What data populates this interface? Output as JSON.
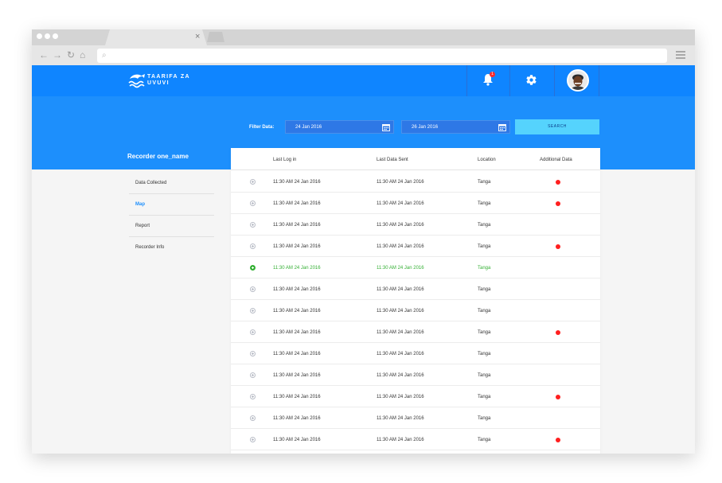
{
  "browser": {
    "tab_close": "×",
    "nav_back": "←",
    "nav_forward": "→",
    "nav_reload": "↻",
    "nav_home": "⌂",
    "url_search_icon": "⌕"
  },
  "app": {
    "logo_line1": "TAARIFA ZA",
    "logo_line2": "UVUVI",
    "notification_count": "1",
    "brand_color": "#0f85ff"
  },
  "filter": {
    "label": "Filter Data:",
    "start_date": "24 Jan 2016",
    "end_date": "26 Jan 2016",
    "search_label": "SEARCH"
  },
  "sidebar": {
    "title": "Recorder one_name",
    "items": [
      {
        "label": "Data Collected",
        "active": false
      },
      {
        "label": "Map",
        "active": true
      },
      {
        "label": "Report",
        "active": false
      },
      {
        "label": "Recorder Info",
        "active": false
      }
    ]
  },
  "table": {
    "columns": [
      "Last Log in",
      "Last Data Sent",
      "Location",
      "Additional Data"
    ],
    "rows": [
      {
        "last_log": "11:30 AM  24 Jan 2016",
        "last_sent": "11:30 AM  24 Jan 2016",
        "location": "Tanga",
        "additional": true,
        "highlight": false
      },
      {
        "last_log": "11:30 AM  24 Jan 2016",
        "last_sent": "11:30 AM  24 Jan 2016",
        "location": "Tanga",
        "additional": true,
        "highlight": false
      },
      {
        "last_log": "11:30 AM  24 Jan 2016",
        "last_sent": "11:30 AM  24 Jan 2016",
        "location": "Tanga",
        "additional": false,
        "highlight": false
      },
      {
        "last_log": "11:30 AM  24 Jan 2016",
        "last_sent": "11:30 AM  24 Jan 2016",
        "location": "Tanga",
        "additional": true,
        "highlight": false
      },
      {
        "last_log": "11:30 AM  24 Jan 2016",
        "last_sent": "11:30 AM  24 Jan 2016",
        "location": "Tanga",
        "additional": false,
        "highlight": true
      },
      {
        "last_log": "11:30 AM  24 Jan 2016",
        "last_sent": "11:30 AM  24 Jan 2016",
        "location": "Tanga",
        "additional": false,
        "highlight": false
      },
      {
        "last_log": "11:30 AM  24 Jan 2016",
        "last_sent": "11:30 AM  24 Jan 2016",
        "location": "Tanga",
        "additional": false,
        "highlight": false
      },
      {
        "last_log": "11:30 AM  24 Jan 2016",
        "last_sent": "11:30 AM  24 Jan 2016",
        "location": "Tanga",
        "additional": true,
        "highlight": false
      },
      {
        "last_log": "11:30 AM  24 Jan 2016",
        "last_sent": "11:30 AM  24 Jan 2016",
        "location": "Tanga",
        "additional": false,
        "highlight": false
      },
      {
        "last_log": "11:30 AM  24 Jan 2016",
        "last_sent": "11:30 AM  24 Jan 2016",
        "location": "Tanga",
        "additional": false,
        "highlight": false
      },
      {
        "last_log": "11:30 AM  24 Jan 2016",
        "last_sent": "11:30 AM  24 Jan 2016",
        "location": "Tanga",
        "additional": true,
        "highlight": false
      },
      {
        "last_log": "11:30 AM  24 Jan 2016",
        "last_sent": "11:30 AM  24 Jan 2016",
        "location": "Tanga",
        "additional": false,
        "highlight": false
      },
      {
        "last_log": "11:30 AM  24 Jan 2016",
        "last_sent": "11:30 AM  24 Jan 2016",
        "location": "Tanga",
        "additional": true,
        "highlight": false
      }
    ]
  }
}
